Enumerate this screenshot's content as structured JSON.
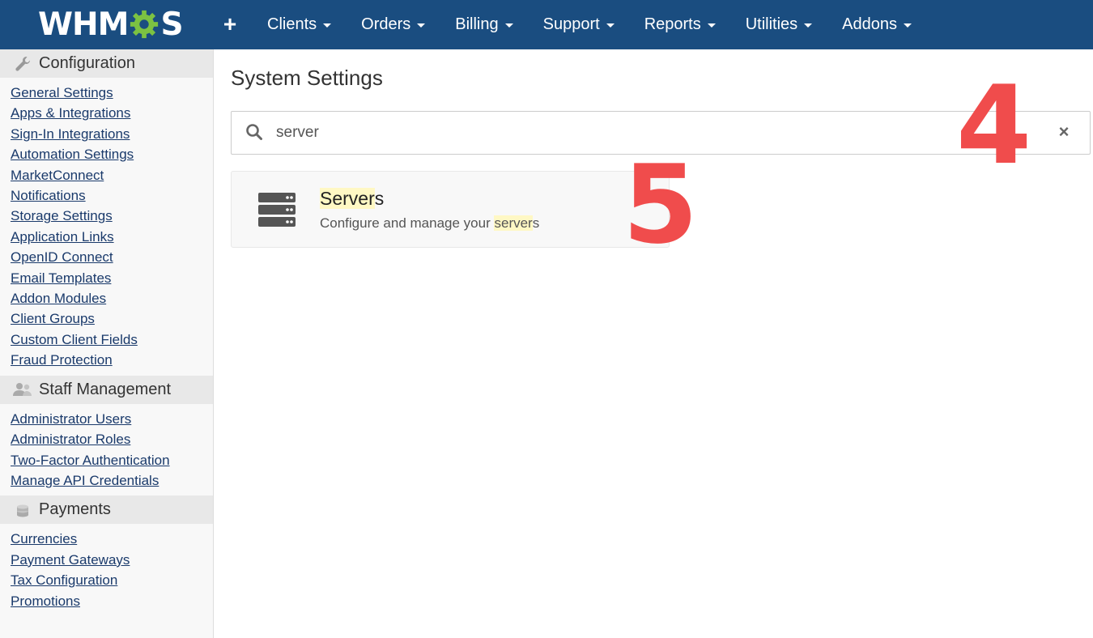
{
  "header": {
    "logo_prefix": "WHM",
    "logo_suffix": "S",
    "plus_label": "+",
    "nav": [
      "Clients",
      "Orders",
      "Billing",
      "Support",
      "Reports",
      "Utilities",
      "Addons"
    ]
  },
  "sidebar": {
    "configuration": {
      "title": "Configuration",
      "links": [
        "General Settings",
        "Apps & Integrations",
        "Sign-In Integrations",
        "Automation Settings",
        "MarketConnect",
        "Notifications",
        "Storage Settings",
        "Application Links",
        "OpenID Connect",
        "Email Templates",
        "Addon Modules",
        "Client Groups",
        "Custom Client Fields",
        "Fraud Protection"
      ]
    },
    "staff": {
      "title": "Staff Management",
      "links": [
        "Administrator Users",
        "Administrator Roles",
        "Two-Factor Authentication",
        "Manage API Credentials"
      ]
    },
    "payments": {
      "title": "Payments",
      "links": [
        "Currencies",
        "Payment Gateways",
        "Tax Configuration",
        "Promotions"
      ]
    }
  },
  "main": {
    "title": "System Settings",
    "search_value": "server",
    "clear_label": "×",
    "result": {
      "title_hl": "Server",
      "title_rest": "s",
      "desc_pre": "Configure and manage your ",
      "desc_hl": "server",
      "desc_post": "s"
    }
  },
  "annotations": {
    "four": "4",
    "five": "5"
  },
  "colors": {
    "topbar": "#1a4d80",
    "highlight": "#fff8c4",
    "annotation": "#f04c4c",
    "gear": "#7cc242"
  }
}
